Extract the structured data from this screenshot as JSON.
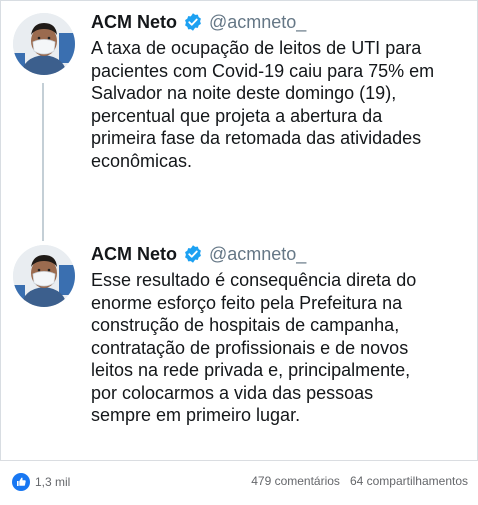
{
  "tweets": [
    {
      "display_name": "ACM Neto",
      "handle": "@acmneto_",
      "text": "A taxa de ocupação de leitos de UTI para\npacientes com Covid-19 caiu para 75% em\nSalvador na noite deste domingo (19),\npercentual que projeta a abertura da\nprimeira fase da retomada das atividades\neconômicas."
    },
    {
      "display_name": "ACM Neto",
      "handle": "@acmneto_",
      "text": "Esse resultado é consequência direta do\nenorme esforço feito pela Prefeitura na\nconstrução de hospitais de campanha,\ncontratação de profissionais e de novos\nleitos na rede privada e, principalmente,\npor colocarmos a vida das pessoas\nsempre em primeiro lugar."
    }
  ],
  "footer": {
    "reaction_count": "1,3 mil",
    "comments": "479 comentários",
    "shares": "64 compartilhamentos"
  },
  "colors": {
    "verified": "#1da1f2",
    "like": "#1877f2",
    "handle": "#657786",
    "thread_line": "#c4cfd6"
  }
}
